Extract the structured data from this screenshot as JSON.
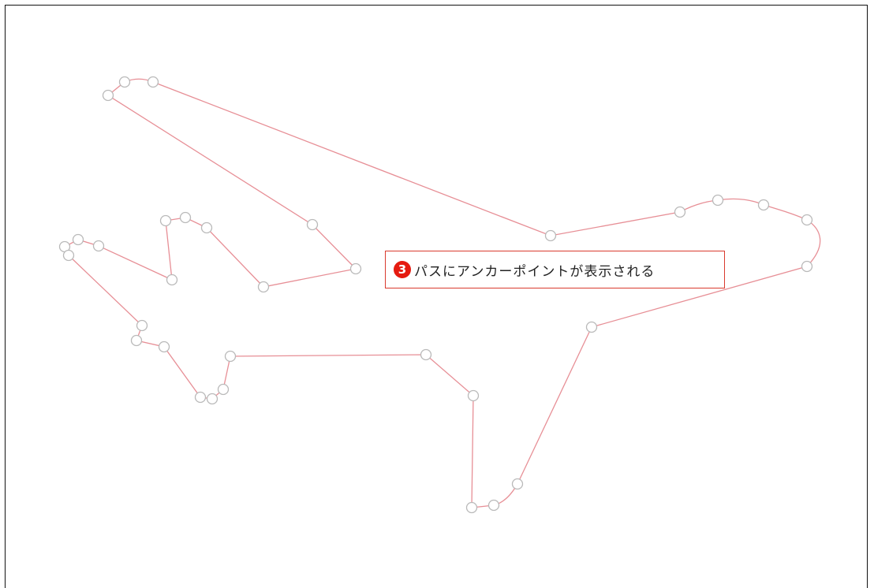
{
  "callout": {
    "step_number": "3",
    "text": "パスにアンカーポイントが表示される"
  },
  "colors": {
    "path_stroke": "#e78f96",
    "anchor_stroke": "#b9b9b9",
    "callout_border": "#d93a2e",
    "badge_fill": "#e51b10"
  },
  "icons": {
    "badge": "numbered-circle-icon",
    "anchor": "anchor-point-circle"
  }
}
